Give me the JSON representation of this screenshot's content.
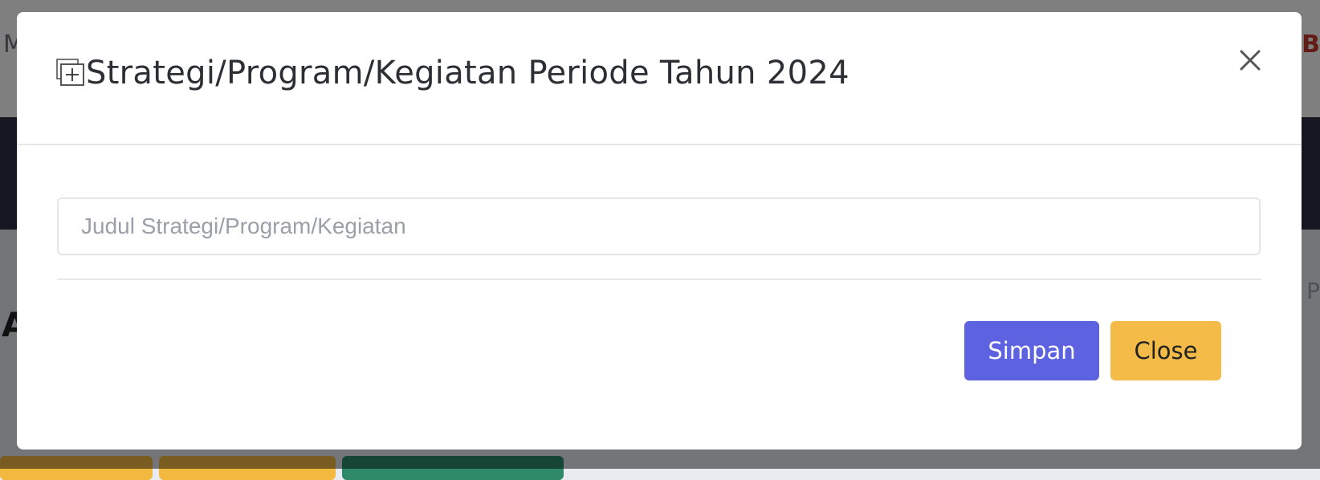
{
  "background": {
    "top_left_text": "M",
    "top_right_text": "B",
    "dark_bar_text": "P",
    "heading_text": "A"
  },
  "modal": {
    "title": "Strategi/Program/Kegiatan Periode Tahun 2024",
    "title_icon": "add-square-icon",
    "close_icon": "close-icon",
    "input": {
      "placeholder": "Judul Strategi/Program/Kegiatan",
      "value": ""
    },
    "buttons": {
      "save_label": "Simpan",
      "close_label": "Close"
    }
  },
  "colors": {
    "primary": "#5d63e0",
    "warning": "#f5bb48",
    "overlay": "rgba(0,0,0,0.5)"
  }
}
